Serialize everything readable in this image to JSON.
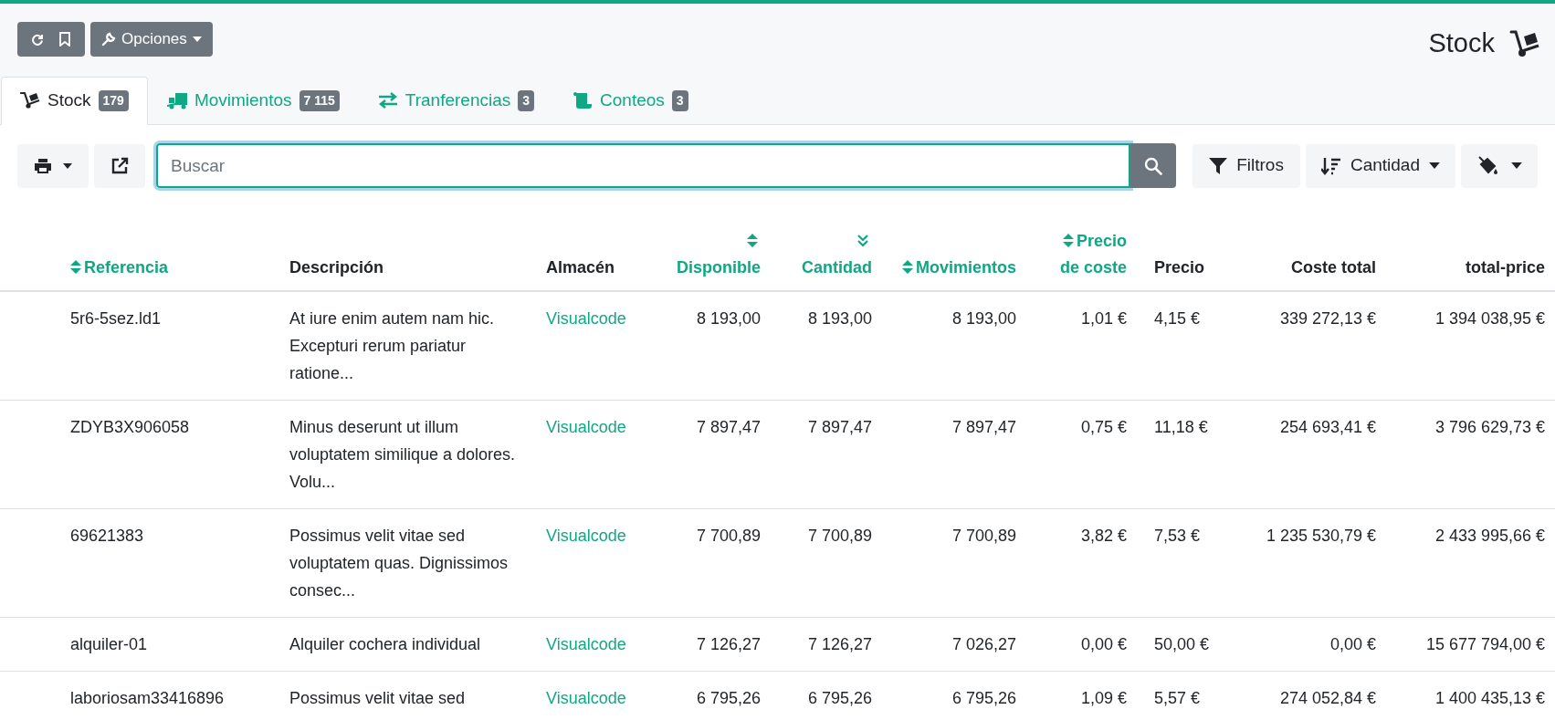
{
  "top_toolbar": {
    "options_label": "Opciones"
  },
  "page_title": "Stock",
  "tabs": [
    {
      "label": "Stock",
      "count": "179",
      "selected": true
    },
    {
      "label": "Movimientos",
      "count": "7 115",
      "selected": false
    },
    {
      "label": "Tranferencias",
      "count": "3",
      "selected": false
    },
    {
      "label": "Conteos",
      "count": "3",
      "selected": false
    }
  ],
  "search": {
    "placeholder": "Buscar"
  },
  "filter_button": "Filtros",
  "sort_button": "Cantidad",
  "table": {
    "columns": [
      {
        "label": "Referencia",
        "kind": "sortable"
      },
      {
        "label": "Descripción",
        "kind": "plain"
      },
      {
        "label": "Almacén",
        "kind": "plain"
      },
      {
        "label": "Disponible",
        "kind": "sortable"
      },
      {
        "label": "Cantidad",
        "kind": "sorted_desc"
      },
      {
        "label": "Movimientos",
        "kind": "sortable"
      },
      {
        "label": "Precio de coste",
        "kind": "sortable"
      },
      {
        "label": "Precio",
        "kind": "plain"
      },
      {
        "label": "Coste total",
        "kind": "plain"
      },
      {
        "label": "total-price",
        "kind": "plain"
      }
    ],
    "rows": [
      [
        "5r6-5sez.ld1",
        "At iure enim autem nam hic. Excepturi rerum pariatur ratione...",
        "Visualcode",
        "8 193,00",
        "8 193,00",
        "8 193,00",
        "1,01 €",
        "4,15 €",
        "339 272,13 €",
        "1 394 038,95 €"
      ],
      [
        "ZDYB3X906058",
        "Minus deserunt ut illum voluptatem similique a dolores. Volu...",
        "Visualcode",
        "7 897,47",
        "7 897,47",
        "7 897,47",
        "0,75 €",
        "11,18 €",
        "254 693,41 €",
        "3 796 629,73 €"
      ],
      [
        "69621383",
        "Possimus velit vitae sed voluptatem quas. Dignissimos consec...",
        "Visualcode",
        "7 700,89",
        "7 700,89",
        "7 700,89",
        "3,82 €",
        "7,53 €",
        "1 235 530,79 €",
        "2 433 995,66 €"
      ],
      [
        "alquiler-01",
        "Alquiler cochera individual",
        "Visualcode",
        "7 126,27",
        "7 126,27",
        "7 026,27",
        "0,00 €",
        "50,00 €",
        "0,00 €",
        "15 677 794,00 €"
      ],
      [
        "laboriosam33416896",
        "Possimus velit vitae sed",
        "Visualcode",
        "6 795,26",
        "6 795,26",
        "6 795,26",
        "1,09 €",
        "5,57 €",
        "274 052,84 €",
        "1 400 435,13 €"
      ]
    ]
  }
}
